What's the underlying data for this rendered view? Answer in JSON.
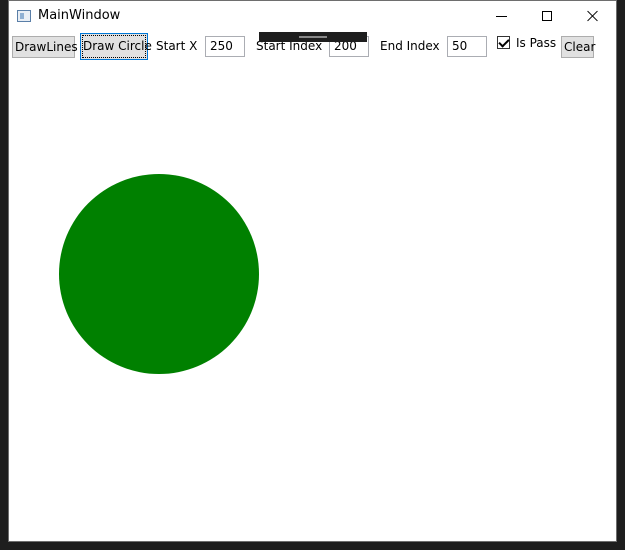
{
  "window": {
    "title": "MainWindow"
  },
  "toolbar": {
    "draw_lines_label": "DrawLines",
    "draw_circle_label": "Draw Circle",
    "start_x_label": "Start X",
    "start_x_value": "250",
    "start_index_label": "Start Index",
    "start_index_value": "200",
    "end_index_label": "End Index",
    "end_index_value": "50",
    "is_pass_label": "Is Pass",
    "is_pass_checked": true,
    "clear_label": "Clear"
  },
  "canvas": {
    "shape": "circle",
    "fill_color": "#008000"
  },
  "icons": {
    "app": "app-window-icon",
    "minimize": "minimize-icon",
    "maximize": "maximize-icon",
    "close": "close-icon",
    "check": "check-icon"
  }
}
